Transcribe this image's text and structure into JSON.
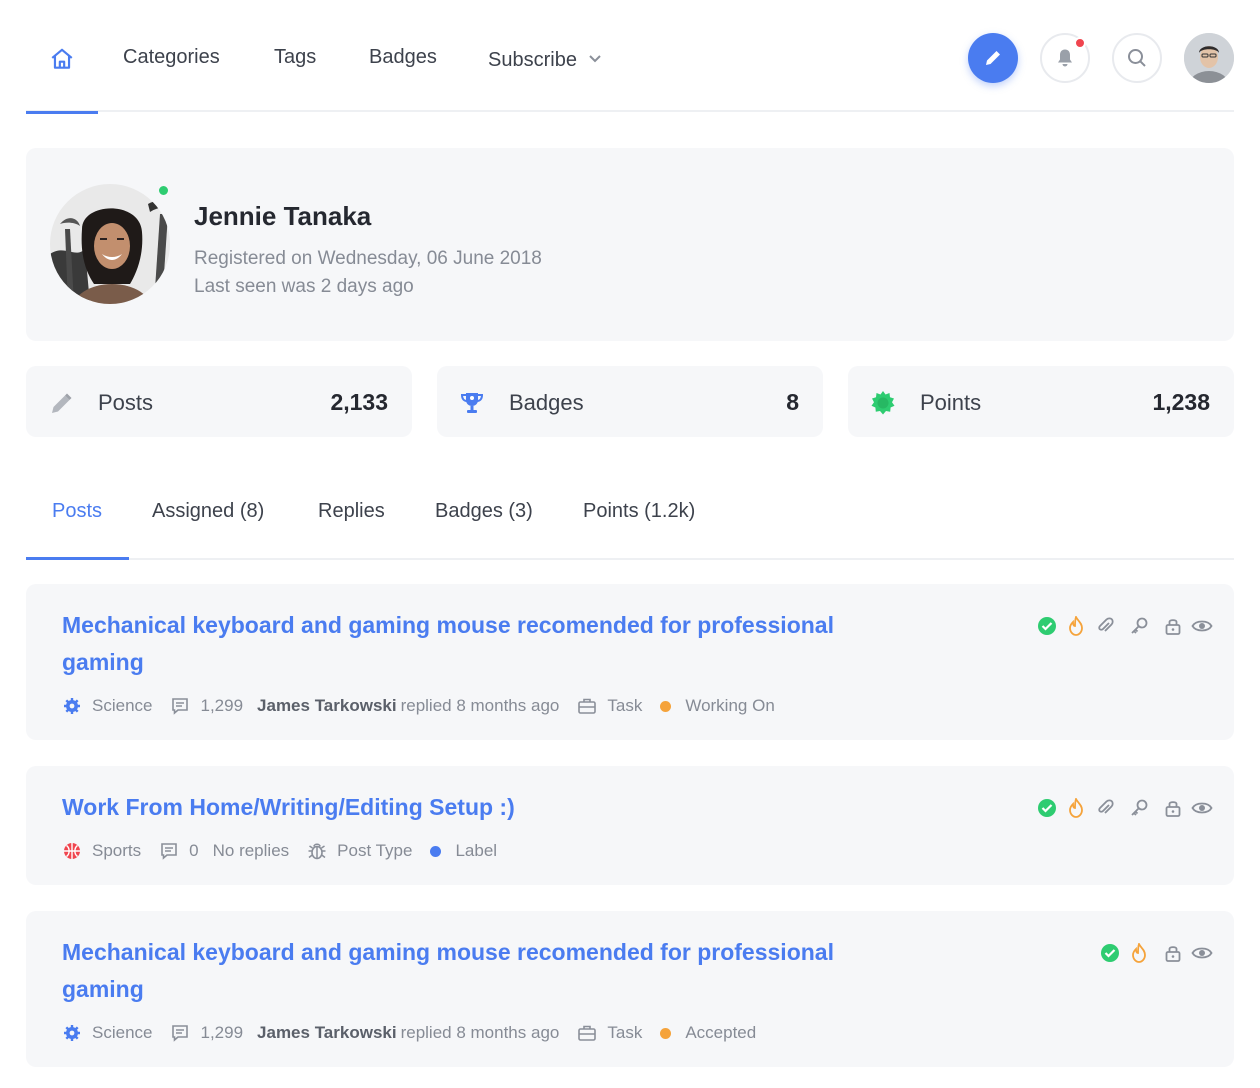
{
  "nav": {
    "items": [
      {
        "label": "Categories"
      },
      {
        "label": "Tags"
      },
      {
        "label": "Badges"
      },
      {
        "label": "Subscribe"
      }
    ]
  },
  "colors": {
    "accent": "#4a7cf0",
    "online": "#2ecc71",
    "notification": "#f0454f",
    "status_working": "#f5a33b",
    "status_label": "#4a7cf0",
    "status_accepted": "#f5a33b",
    "check": "#2ecc71"
  },
  "profile": {
    "name": "Jennie Tanaka",
    "registered": "Registered on Wednesday, 06 June 2018",
    "last_seen": "Last seen was 2 days ago"
  },
  "stats": [
    {
      "label": "Posts",
      "value": "2,133",
      "icon": "pencil-icon"
    },
    {
      "label": "Badges",
      "value": "8",
      "icon": "trophy-icon"
    },
    {
      "label": "Points",
      "value": "1,238",
      "icon": "badge-star-icon"
    }
  ],
  "tabs": [
    {
      "label": "Posts"
    },
    {
      "label": "Assigned (8)"
    },
    {
      "label": "Replies"
    },
    {
      "label": "Badges (3)"
    },
    {
      "label": "Points (1.2k)"
    }
  ],
  "posts": [
    {
      "title": "Mechanical keyboard and gaming mouse recomended for professional gaming",
      "category": "Science",
      "replies_count": "1,299",
      "reply_user": "James Tarkowski",
      "reply_text": "replied 8 months ago",
      "type": "Task",
      "status": "Working On"
    },
    {
      "title": "Work From Home/Writing/Editing Setup :)",
      "category": "Sports",
      "replies_count": "0",
      "reply_text": "No replies",
      "type": "Post Type",
      "status": "Label"
    },
    {
      "title": "Mechanical keyboard and gaming mouse recomended for professional gaming",
      "category": "Science",
      "replies_count": "1,299",
      "reply_user": "James Tarkowski",
      "reply_text": "replied 8 months ago",
      "type": "Task",
      "status": "Accepted"
    }
  ]
}
